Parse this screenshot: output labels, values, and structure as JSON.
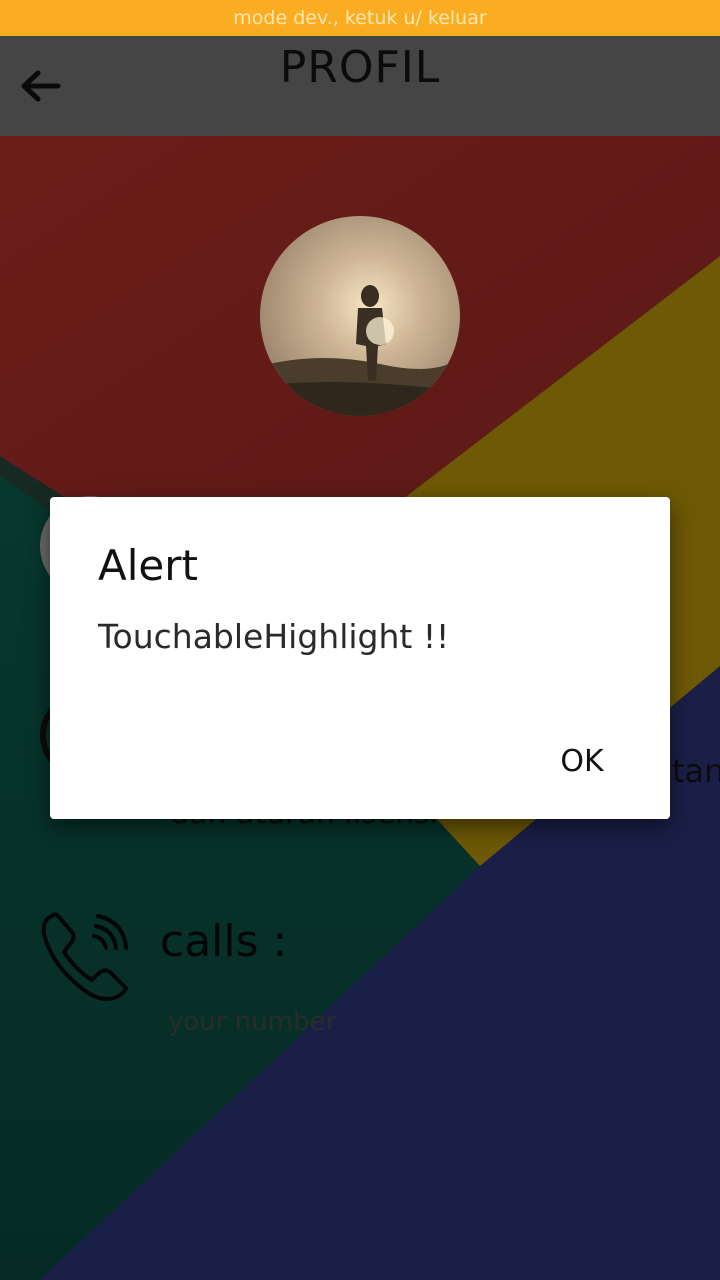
{
  "dev_banner": {
    "text": "mode dev., ketuk u/ keluar"
  },
  "header": {
    "title": "PROFIL",
    "back_icon": "arrow-left-icon"
  },
  "profile": {
    "photo_icon": "person-walking-sunset-photo",
    "info_visible_tail": "tan",
    "info_second_line_partial": "dan aturan lisensi"
  },
  "contact": {
    "calls_label": "calls :",
    "number_placeholder": "your number",
    "phone_icon": "phone-ringing-icon"
  },
  "alert": {
    "title": "Alert",
    "message": "TouchableHighlight  !!",
    "ok_label": "OK"
  },
  "colors": {
    "dev_banner": "#fbad22",
    "header": "#454545",
    "red": "#651b18",
    "mustard": "#6e5a05",
    "teal": "#06352c",
    "navy": "#1a1f48"
  }
}
